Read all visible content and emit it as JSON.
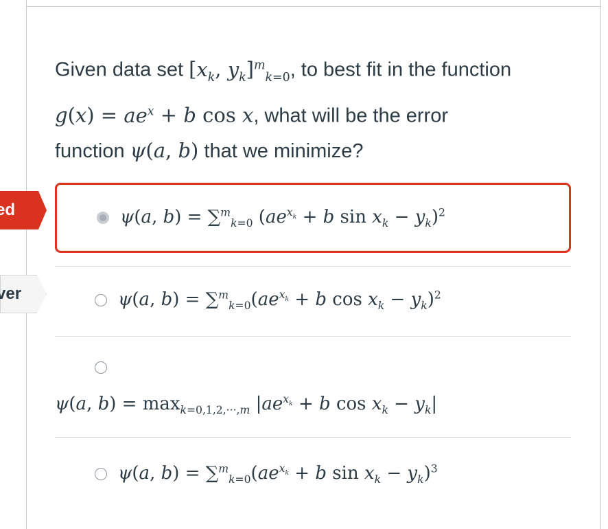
{
  "flags": {
    "selected_label": "ed",
    "answer_label": "ver"
  },
  "question": {
    "line1_a": "Given data set ",
    "line1_b": ", to best fit in the function",
    "line2_b": ", what will be the error",
    "line3_a": "function ",
    "line3_b": " that we minimize?"
  },
  "answers": [
    {
      "selected": true,
      "formula": "ψ(a, b) = ∑ (ae^x_k + b sin x_k − y_k)²"
    },
    {
      "selected": false,
      "formula": "ψ(a, b) = ∑ (ae^x_k + b cos x_k − y_k)²"
    },
    {
      "selected": false,
      "formula": "ψ(a, b) = max |ae^x_k + b cos x_k − y_k|"
    },
    {
      "selected": false,
      "formula": "ψ(a, b) = ∑ (ae^x_k + b sin x_k − y_k)³"
    }
  ],
  "colors": {
    "incorrect": "#d9321f",
    "text": "#2d3b45",
    "border": "#c7cdd1"
  }
}
